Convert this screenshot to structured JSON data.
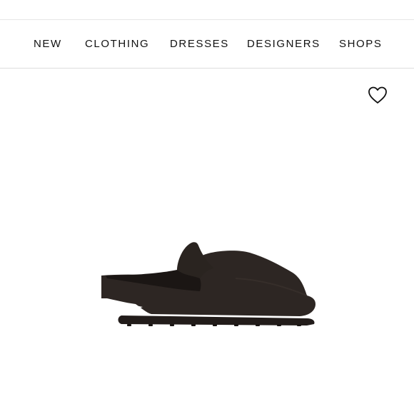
{
  "nav": {
    "items": [
      {
        "label": "NEW"
      },
      {
        "label": "CLOTHING"
      },
      {
        "label": "DRESSES"
      },
      {
        "label": "DESIGNERS"
      },
      {
        "label": "SHOPS"
      }
    ]
  },
  "product": {
    "wishlist_icon": "heart-outline-icon",
    "image_subject": "dark brown rubber slingback clog",
    "image_color": "#2b2522"
  }
}
